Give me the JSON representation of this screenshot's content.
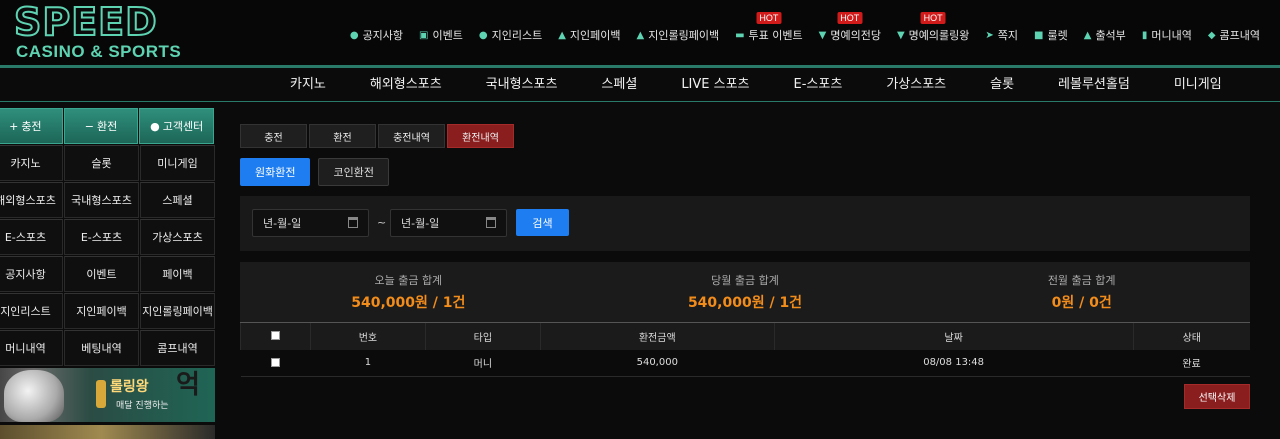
{
  "logo": {
    "top": "SPEED",
    "bottom": "CASINO & SPORTS"
  },
  "topnav": [
    {
      "icon": "info-icon",
      "glyph": "●",
      "label": "공지사항",
      "hot": ""
    },
    {
      "icon": "calendar-icon",
      "glyph": "▣",
      "label": "이벤트",
      "hot": ""
    },
    {
      "icon": "users-icon",
      "glyph": "●",
      "label": "지인리스트",
      "hot": ""
    },
    {
      "icon": "hand-coin-icon",
      "glyph": "▲",
      "label": "지인페이백",
      "hot": ""
    },
    {
      "icon": "hand-coin-icon",
      "glyph": "▲",
      "label": "지인롤링페이백",
      "hot": ""
    },
    {
      "icon": "vote-icon",
      "glyph": "▬",
      "label": "투표 이벤트",
      "hot": "HOT"
    },
    {
      "icon": "trophy-icon",
      "glyph": "▼",
      "label": "명예의전당",
      "hot": "HOT"
    },
    {
      "icon": "trophy-icon",
      "glyph": "▼",
      "label": "명예의롤링왕",
      "hot": "HOT"
    },
    {
      "icon": "paper-plane-icon",
      "glyph": "➤",
      "label": "쪽지",
      "hot": ""
    },
    {
      "icon": "gift-icon",
      "glyph": "■",
      "label": "룰렛",
      "hot": ""
    },
    {
      "icon": "stamp-icon",
      "glyph": "▲",
      "label": "출석부",
      "hot": ""
    },
    {
      "icon": "clipboard-icon",
      "glyph": "▮",
      "label": "머니내역",
      "hot": ""
    },
    {
      "icon": "hand-icon",
      "glyph": "◆",
      "label": "콤프내역",
      "hot": ""
    }
  ],
  "mainnav": [
    "카지노",
    "해외형스포츠",
    "국내형스포츠",
    "스페셜",
    "LIVE 스포츠",
    "E-스포츠",
    "가상스포츠",
    "슬롯",
    "레볼루션홀덤",
    "미니게임"
  ],
  "sidebar": {
    "top_buttons": [
      {
        "icon": "plus-icon",
        "glyph": "+",
        "label": "충전"
      },
      {
        "icon": "minus-icon",
        "glyph": "−",
        "label": "환전"
      },
      {
        "icon": "info-icon",
        "glyph": "●",
        "label": "고객센터"
      }
    ],
    "grid": [
      "카지노",
      "슬롯",
      "미니게임",
      "해외형스포츠",
      "국내형스포츠",
      "스페셜",
      "E-스포츠",
      "E-스포츠",
      "가상스포츠",
      "공지사항",
      "이벤트",
      "페이백",
      "지인리스트",
      "지인페이백",
      "지인롤링페이백",
      "머니내역",
      "베팅내역",
      "콤프내역"
    ],
    "banner": {
      "title": "롤링왕",
      "sub": "매달 진행하는",
      "big": "억"
    }
  },
  "tabs": [
    {
      "label": "충전",
      "active": false
    },
    {
      "label": "환전",
      "active": false
    },
    {
      "label": "충전내역",
      "active": false
    },
    {
      "label": "환전내역",
      "active": true
    }
  ],
  "subtabs": [
    {
      "label": "원화환전",
      "active": true
    },
    {
      "label": "코인환전",
      "active": false
    }
  ],
  "filter": {
    "date_from": "년-월-일",
    "tilde": "~",
    "date_to": "년-월-일",
    "search_label": "검색"
  },
  "summary": [
    {
      "label": "오늘 출금 합계",
      "value": "540,000원 / 1건"
    },
    {
      "label": "당월 출금 합계",
      "value": "540,000원 / 1건"
    },
    {
      "label": "전월 출금 합계",
      "value": "0원 / 0건"
    }
  ],
  "table": {
    "headers": [
      "",
      "번호",
      "타입",
      "환전금액",
      "날짜",
      "상태"
    ],
    "rows": [
      {
        "no": "1",
        "type": "머니",
        "amount": "540,000",
        "date": "08/08 13:48",
        "status": "완료"
      }
    ]
  },
  "delete_label": "선택삭제",
  "colors": {
    "accent": "#5ed3b2",
    "blue": "#1e7df0",
    "red": "#8a1d1d",
    "orange": "#f28c1a",
    "hot": "#d11a1a"
  }
}
